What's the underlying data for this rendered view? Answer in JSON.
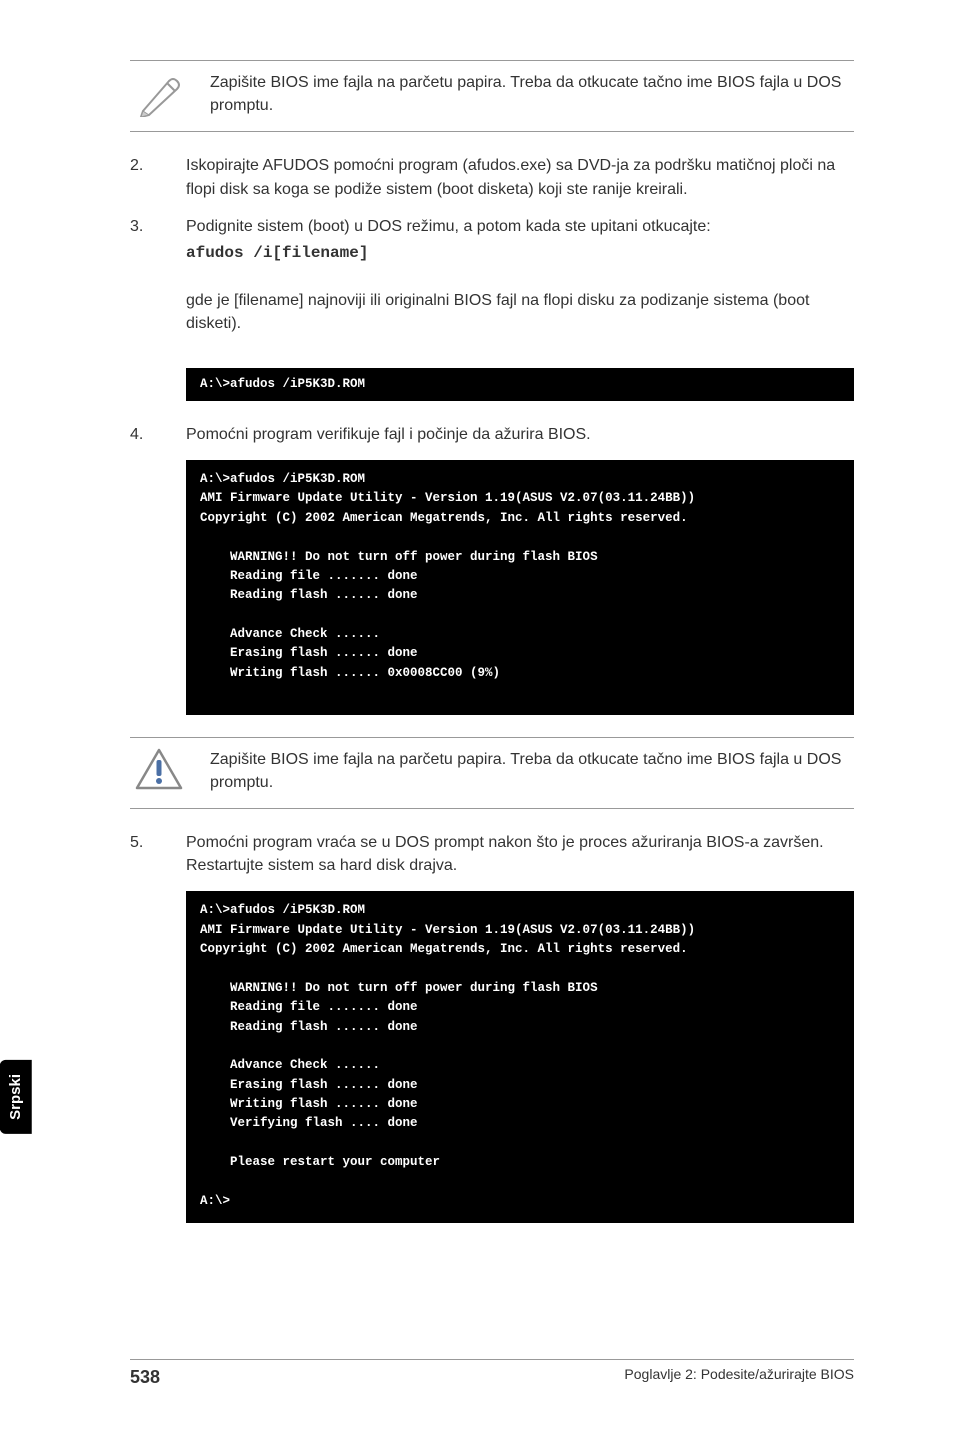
{
  "note1": {
    "text": "Zapišite BIOS ime fajla na parčetu papira. Treba da otkucate tačno ime BIOS fajla u DOS promptu."
  },
  "step2": {
    "num": "2.",
    "text": "Iskopirajte AFUDOS pomoćni program (afudos.exe) sa DVD-ja za podršku matičnoj ploči na flopi disk sa koga se podiže sistem (boot disketa) koji ste ranije kreirali."
  },
  "step3": {
    "num": "3.",
    "text": "Podignite sistem (boot) u DOS režimu, a potom kada ste upitani otkucajte:",
    "cmd": "afudos /i[filename]",
    "after": "gde je [filename] najnoviji ili originalni BIOS fajl na flopi disku za podizanje sistema (boot disketi)."
  },
  "codebox1": "A:\\>afudos /iP5K3D.ROM",
  "step4": {
    "num": "4.",
    "text": "Pomoćni program verifikuje fajl i počinje da ažurira BIOS."
  },
  "codebox2": "A:\\>afudos /iP5K3D.ROM\nAMI Firmware Update Utility - Version 1.19(ASUS V2.07(03.11.24BB))\nCopyright (C) 2002 American Megatrends, Inc. All rights reserved.\n\n    WARNING!! Do not turn off power during flash BIOS\n    Reading file ....... done\n    Reading flash ...... done\n\n    Advance Check ......\n    Erasing flash ...... done\n    Writing flash ...... 0x0008CC00 (9%)\n\n",
  "note2": {
    "text": "Zapišite BIOS ime fajla na parčetu papira. Treba da otkucate tačno ime BIOS fajla u DOS promptu."
  },
  "step5": {
    "num": "5.",
    "text": "Pomoćni program vraća se u DOS prompt nakon što je proces ažuriranja BIOS-a završen.  Restartujte sistem sa hard disk drajva."
  },
  "codebox3": "A:\\>afudos /iP5K3D.ROM\nAMI Firmware Update Utility - Version 1.19(ASUS V2.07(03.11.24BB))\nCopyright (C) 2002 American Megatrends, Inc. All rights reserved.\n\n    WARNING!! Do not turn off power during flash BIOS\n    Reading file ....... done\n    Reading flash ...... done\n\n    Advance Check ......\n    Erasing flash ...... done\n    Writing flash ...... done\n    Verifying flash .... done\n\n    Please restart your computer\n\nA:\\>",
  "sidebar": {
    "label": "Srpski"
  },
  "footer": {
    "page": "538",
    "chapter": "Poglavlje 2: Podesite/ažurirajte BIOS"
  }
}
